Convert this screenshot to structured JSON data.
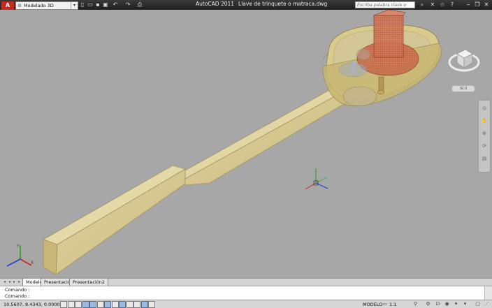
{
  "app": {
    "title": "AutoCAD 2011",
    "document": "Llave de trinquete o matraca.dwg",
    "menu_button": "A",
    "workspace": "Modelado 3D",
    "search_placeholder": "Escriba palabra clave o frase"
  },
  "quick_access_icons": [
    "new-icon",
    "open-icon",
    "save-icon",
    "saveas-icon",
    "undo-icon",
    "redo-icon",
    "plot-icon"
  ],
  "title_icons": [
    "binoculars-icon",
    "exchange-icon",
    "star-icon",
    "help-icon"
  ],
  "window_controls": [
    "minimize-icon",
    "restore-icon",
    "close-icon"
  ],
  "viewcube": {
    "face_label": "SUPERIOR",
    "wcs_label": "SCU"
  },
  "navbar_icons": [
    "steering-wheel-icon",
    "pan-icon",
    "zoom-icon",
    "orbit-icon",
    "showmotion-icon"
  ],
  "layout_tabs": [
    {
      "label": "Modelo",
      "active": true
    },
    {
      "label": "Presentación1",
      "active": false
    },
    {
      "label": "Presentación2",
      "active": false
    }
  ],
  "command": {
    "line1": "Comando :",
    "line2": "Comando :"
  },
  "status": {
    "coordinates": "10.5607, 8.4343, 0.0000",
    "space": "MODELO",
    "scale": "1:1"
  },
  "status_toggles": [
    "snap",
    "grid",
    "ortho",
    "polar",
    "osnap",
    "3dosnap",
    "otrack",
    "ducs",
    "dyn",
    "lwt",
    "tpy",
    "qp",
    "sc"
  ],
  "status_toggle_on": [
    false,
    false,
    false,
    true,
    true,
    false,
    true,
    false,
    true,
    false,
    false,
    true,
    false
  ],
  "colors": {
    "viewport_bg": "#a7a7a8",
    "wrench_fill": "#d8c88e",
    "gear_fill": "#c86a4a",
    "title_bar": "#2a2a2a"
  }
}
